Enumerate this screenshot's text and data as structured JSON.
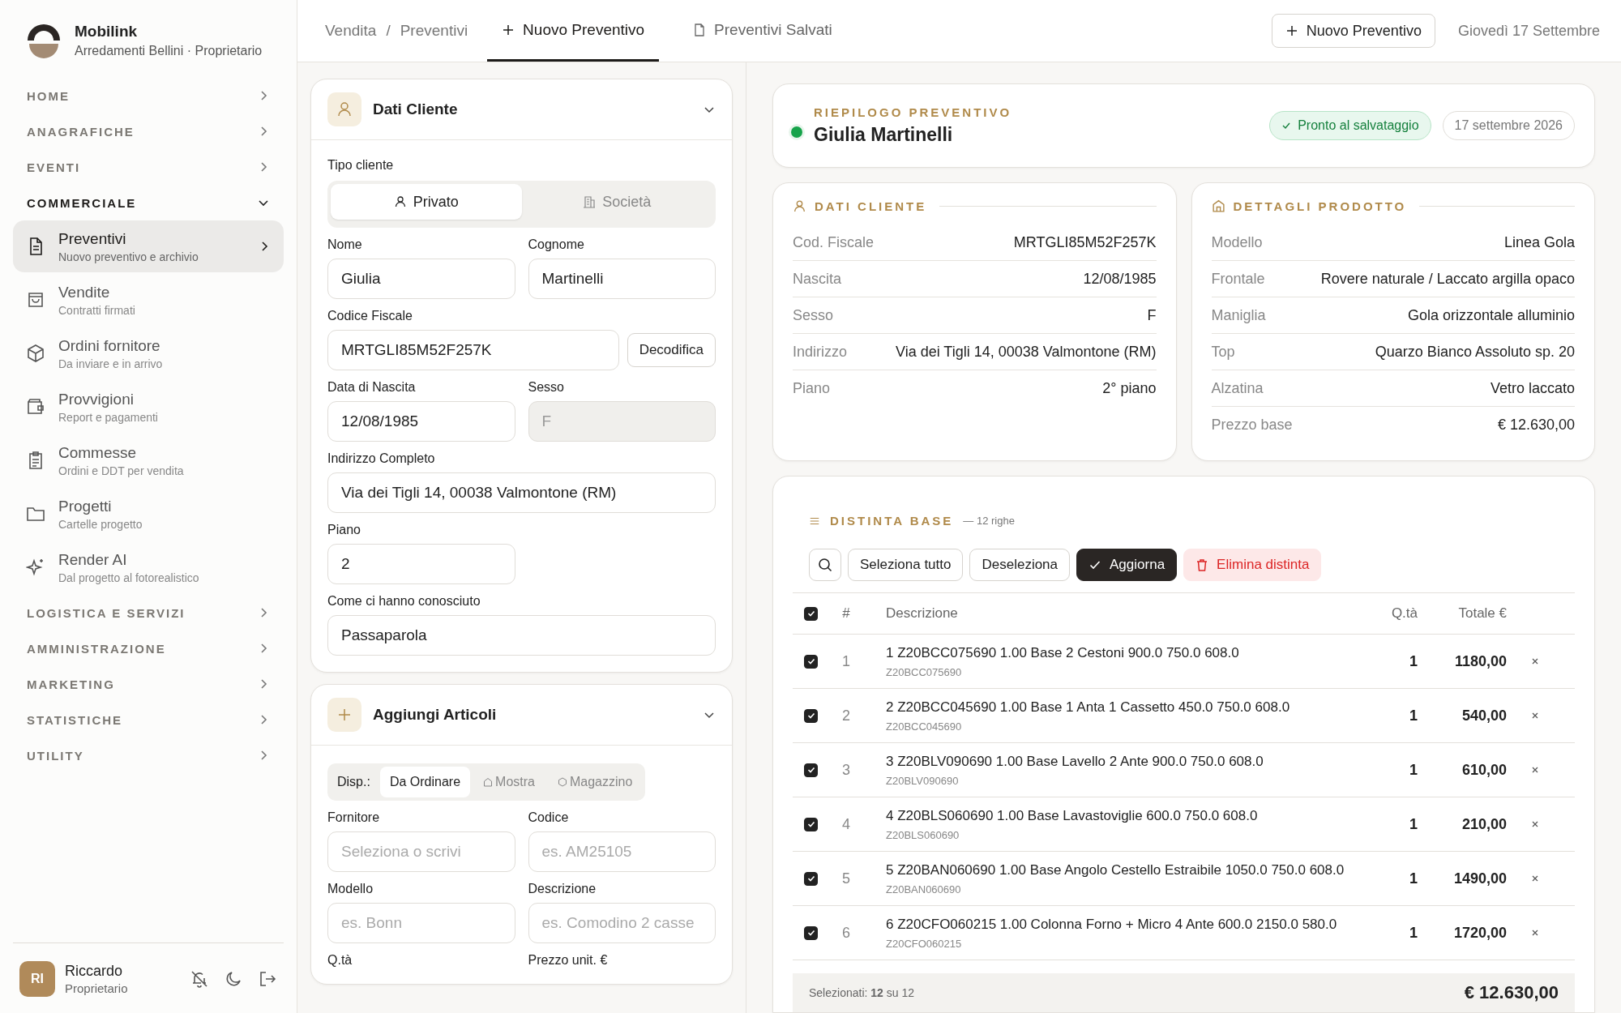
{
  "sidebar": {
    "brand": "Mobilink",
    "subtitle": "Arredamenti Bellini · Proprietario",
    "sections": [
      {
        "label": "HOME",
        "expanded": false
      },
      {
        "label": "ANAGRAFICHE",
        "expanded": false
      },
      {
        "label": "EVENTI",
        "expanded": false
      },
      {
        "label": "COMMERCIALE",
        "expanded": true,
        "items": [
          {
            "label": "Preventivi",
            "sub": "Nuovo preventivo e archivio",
            "selected": true
          },
          {
            "label": "Vendite",
            "sub": "Contratti firmati",
            "selected": false
          },
          {
            "label": "Ordini fornitore",
            "sub": "Da inviare e in arrivo",
            "selected": false
          },
          {
            "label": "Provvigioni",
            "sub": "Report e pagamenti",
            "selected": false
          },
          {
            "label": "Commesse",
            "sub": "Ordini e DDT per vendita",
            "selected": false
          },
          {
            "label": "Progetti",
            "sub": "Cartelle progetto",
            "selected": false
          },
          {
            "label": "Render AI",
            "sub": "Dal progetto al fotorealistico",
            "selected": false
          }
        ]
      },
      {
        "label": "LOGISTICA E SERVIZI",
        "expanded": false
      },
      {
        "label": "AMMINISTRAZIONE",
        "expanded": false
      },
      {
        "label": "MARKETING",
        "expanded": false
      },
      {
        "label": "STATISTICHE",
        "expanded": false
      },
      {
        "label": "UTILITY",
        "expanded": false
      }
    ],
    "user": {
      "initials": "RI",
      "name": "Riccardo",
      "role": "Proprietario"
    }
  },
  "topbar": {
    "breadcrumb": [
      "Vendita",
      "Preventivi"
    ],
    "breadcrumb_separator": "/",
    "tabs": [
      {
        "label": "Nuovo Preventivo",
        "selected": true
      },
      {
        "label": "Preventivi Salvati",
        "selected": false
      }
    ],
    "button": "Nuovo Preventivo",
    "date": "Giovedì 17 Settembre"
  },
  "client_form": {
    "title": "Dati Cliente",
    "expanded": true,
    "type_label": "Tipo cliente",
    "type_options": [
      {
        "label": "Privato",
        "selected": true
      },
      {
        "label": "Società",
        "selected": false
      }
    ],
    "rows": [
      {
        "fields": [
          {
            "label": "Nome",
            "value": "Giulia",
            "kind": "half",
            "disabled": false
          },
          {
            "label": "Cognome",
            "value": "Martinelli",
            "kind": "half",
            "disabled": false
          }
        ]
      },
      {
        "fields": [
          {
            "label": "Codice Fiscale",
            "value": "MRTGLI85M52F257K",
            "kind": "action",
            "action": "Decodifica",
            "disabled": false
          }
        ]
      },
      {
        "fields": [
          {
            "label": "Data di Nascita",
            "value": "12/08/1985",
            "kind": "half",
            "disabled": false
          },
          {
            "label": "Sesso",
            "value": "F",
            "kind": "half",
            "disabled": true
          }
        ]
      },
      {
        "fields": [
          {
            "label": "Indirizzo Completo",
            "value": "Via dei Tigli 14, 00038 Valmontone (RM)",
            "kind": "full",
            "disabled": false
          }
        ]
      },
      {
        "fields": [
          {
            "label": "Piano",
            "value": "2",
            "kind": "half",
            "disabled": false
          }
        ]
      },
      {
        "fields": [
          {
            "label": "Come ci hanno conosciuto",
            "value": "Passaparola",
            "kind": "full",
            "disabled": false
          }
        ]
      }
    ]
  },
  "articles_form": {
    "title": "Aggiungi Articoli",
    "expanded": true,
    "disp_label": "Disp.:",
    "disp_options": [
      {
        "label": "Da Ordinare",
        "selected": true
      },
      {
        "label": "Mostra",
        "selected": false
      },
      {
        "label": "Magazzino",
        "selected": false
      }
    ],
    "rows": [
      {
        "fields": [
          {
            "label": "Fornitore",
            "placeholder": "Seleziona o scrivi",
            "kind": "half"
          },
          {
            "label": "Codice",
            "placeholder": "es. AM25105",
            "kind": "half"
          }
        ]
      },
      {
        "fields": [
          {
            "label": "Modello",
            "placeholder": "es. Bonn",
            "kind": "half"
          },
          {
            "label": "Descrizione",
            "placeholder": "es. Comodino 2 casse",
            "kind": "half"
          }
        ]
      },
      {
        "fields": [
          {
            "label": "Q.tà",
            "kind": "label"
          },
          {
            "label": "Prezzo unit. €",
            "kind": "label"
          }
        ]
      }
    ]
  },
  "summary": {
    "kicker": "RIEPILOGO PREVENTIVO",
    "name": "Giulia Martinelli",
    "status": "Pronto al salvataggio",
    "date": "17 settembre 2026"
  },
  "detail_cards": [
    {
      "title": "DATI CLIENTE",
      "rows": [
        {
          "label": "Cod. Fiscale",
          "value": "MRTGLI85M52F257K"
        },
        {
          "label": "Nascita",
          "value": "12/08/1985"
        },
        {
          "label": "Sesso",
          "value": "F"
        },
        {
          "label": "Indirizzo",
          "value": "Via dei Tigli 14, 00038 Valmontone (RM)"
        },
        {
          "label": "Piano",
          "value": "2° piano"
        }
      ]
    },
    {
      "title": "DETTAGLI PRODOTTO",
      "rows": [
        {
          "label": "Modello",
          "value": "Linea Gola"
        },
        {
          "label": "Frontale",
          "value": "Rovere naturale / Laccato argilla opaco"
        },
        {
          "label": "Maniglia",
          "value": "Gola orizzontale alluminio"
        },
        {
          "label": "Top",
          "value": "Quarzo Bianco Assoluto sp. 20"
        },
        {
          "label": "Alzatina",
          "value": "Vetro laccato"
        },
        {
          "label": "Prezzo base",
          "value": "€ 12.630,00"
        }
      ]
    }
  ],
  "bom": {
    "title": "DISTINTA BASE",
    "count": "— 12 righe",
    "buttons": [
      {
        "label": "Seleziona tutto",
        "kind": "outline"
      },
      {
        "label": "Deseleziona",
        "kind": "outline"
      },
      {
        "label": "Aggiorna",
        "kind": "primary"
      },
      {
        "label": "Elimina distinta",
        "kind": "danger"
      }
    ],
    "all_checked": true,
    "columns": [
      "#",
      "Descrizione",
      "Q.tà",
      "Totale €"
    ],
    "rows": [
      {
        "checked": true,
        "n": "1",
        "desc": "1 Z20BCC075690 1.00 Base 2 Cestoni 900.0 750.0 608.0",
        "code": "Z20BCC075690",
        "qty": "1",
        "total": "1180,00"
      },
      {
        "checked": true,
        "n": "2",
        "desc": "2 Z20BCC045690 1.00 Base 1 Anta 1 Cassetto 450.0 750.0 608.0",
        "code": "Z20BCC045690",
        "qty": "1",
        "total": "540,00"
      },
      {
        "checked": true,
        "n": "3",
        "desc": "3 Z20BLV090690 1.00 Base Lavello 2 Ante 900.0 750.0 608.0",
        "code": "Z20BLV090690",
        "qty": "1",
        "total": "610,00"
      },
      {
        "checked": true,
        "n": "4",
        "desc": "4 Z20BLS060690 1.00 Base Lavastoviglie 600.0 750.0 608.0",
        "code": "Z20BLS060690",
        "qty": "1",
        "total": "210,00"
      },
      {
        "checked": true,
        "n": "5",
        "desc": "5 Z20BAN060690 1.00 Base Angolo Cestello Estraibile 1050.0 750.0 608.0",
        "code": "Z20BAN060690",
        "qty": "1",
        "total": "1490,00"
      },
      {
        "checked": true,
        "n": "6",
        "desc": "6 Z20CFO060215 1.00 Colonna Forno + Micro 4 Ante 600.0 2150.0 580.0",
        "code": "Z20CFO060215",
        "qty": "1",
        "total": "1720,00"
      }
    ],
    "footer": "Selezionati: **12** su 12",
    "footer_total": "€ 12.630,00"
  }
}
